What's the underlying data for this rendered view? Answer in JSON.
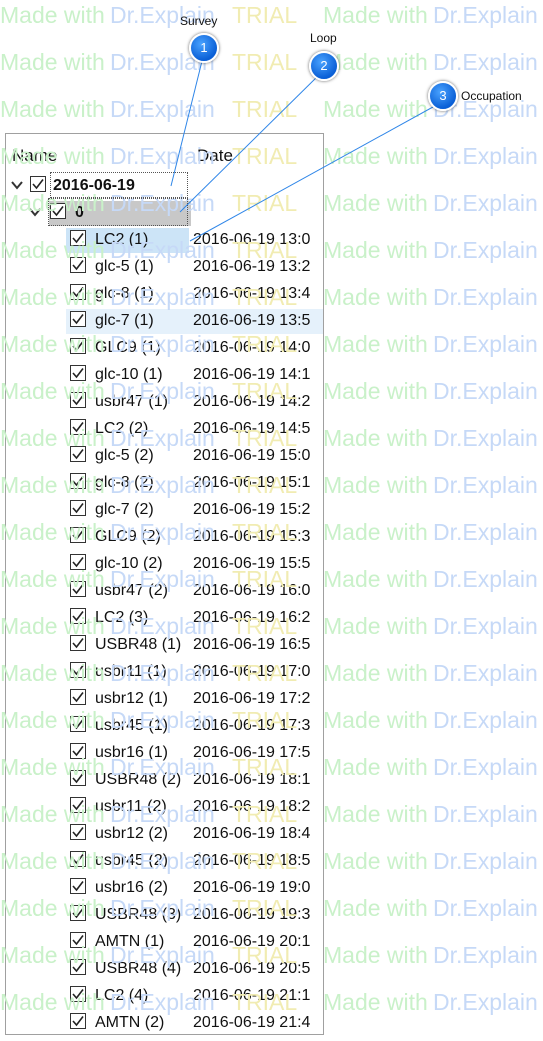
{
  "header": {
    "name_col": "Name",
    "date_col": "Date"
  },
  "watermark": {
    "part1": "Made with",
    "part2": "Dr.Explain",
    "part3": "TRIAL"
  },
  "callouts": [
    {
      "number": "1",
      "label": "Survey"
    },
    {
      "number": "2",
      "label": "Loop"
    },
    {
      "number": "3",
      "label": "Occupation"
    }
  ],
  "tree": {
    "survey": {
      "label": "2016-06-19",
      "checked": true,
      "expanded": true
    },
    "loop": {
      "label": "0",
      "checked": true,
      "expanded": true
    },
    "rows": [
      {
        "name": "LC2 (1)",
        "date": "2016-06-19 13:0"
      },
      {
        "name": "glc-5 (1)",
        "date": "2016-06-19 13:2"
      },
      {
        "name": "glc-8 (1)",
        "date": "2016-06-19 13:4"
      },
      {
        "name": "glc-7 (1)",
        "date": "2016-06-19 13:5"
      },
      {
        "name": "GLC9 (1)",
        "date": "2016-06-19 14:0"
      },
      {
        "name": "glc-10 (1)",
        "date": "2016-06-19 14:1"
      },
      {
        "name": "usbr47 (1)",
        "date": "2016-06-19 14:2"
      },
      {
        "name": "LC2 (2)",
        "date": "2016-06-19 14:5"
      },
      {
        "name": "glc-5 (2)",
        "date": "2016-06-19 15:0"
      },
      {
        "name": "glc-8 (2)",
        "date": "2016-06-19 15:1"
      },
      {
        "name": "glc-7 (2)",
        "date": "2016-06-19 15:2"
      },
      {
        "name": "GLC9 (2)",
        "date": "2016-06-19 15:3"
      },
      {
        "name": "glc-10 (2)",
        "date": "2016-06-19 15:5"
      },
      {
        "name": "usbr47 (2)",
        "date": "2016-06-19 16:0"
      },
      {
        "name": "LC2 (3)",
        "date": "2016-06-19 16:2"
      },
      {
        "name": "USBR48 (1)",
        "date": "2016-06-19 16:5"
      },
      {
        "name": "usbr11 (1)",
        "date": "2016-06-19 17:0"
      },
      {
        "name": "usbr12 (1)",
        "date": "2016-06-19 17:2"
      },
      {
        "name": "usbr45 (1)",
        "date": "2016-06-19 17:3"
      },
      {
        "name": "usbr16 (1)",
        "date": "2016-06-19 17:5"
      },
      {
        "name": "USBR48 (2)",
        "date": "2016-06-19 18:1"
      },
      {
        "name": "usbr11 (2)",
        "date": "2016-06-19 18:2"
      },
      {
        "name": "usbr12 (2)",
        "date": "2016-06-19 18:4"
      },
      {
        "name": "usbr45 (2)",
        "date": "2016-06-19 18:5"
      },
      {
        "name": "usbr16 (2)",
        "date": "2016-06-19 19:0"
      },
      {
        "name": "USBR48 (3)",
        "date": "2016-06-19 19:3"
      },
      {
        "name": "AMTN (1)",
        "date": "2016-06-19 20:1"
      },
      {
        "name": "USBR48 (4)",
        "date": "2016-06-19 20:5"
      },
      {
        "name": "LC2 (4)",
        "date": "2016-06-19 21:1"
      },
      {
        "name": "AMTN (2)",
        "date": "2016-06-19 21:4"
      }
    ],
    "selected_row": 0,
    "hover_row": 3
  }
}
